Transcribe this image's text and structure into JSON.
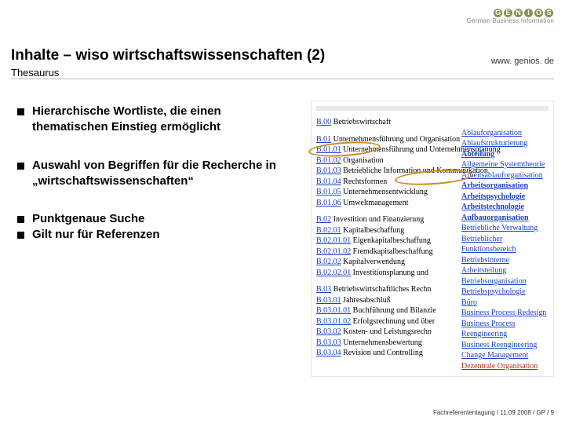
{
  "logo": {
    "letters": [
      "G",
      "E",
      "N",
      "I",
      "O",
      "S"
    ],
    "sub": "German Business Information"
  },
  "header": {
    "title": "Inhalte – wiso wirtschaftswissenschaften (2)",
    "subtitle": "Thesaurus",
    "url": "www. genios. de"
  },
  "bullets": {
    "g1": "Hierarchische Wortliste, die einen thematischen Einstieg ermöglicht",
    "g2": "Auswahl von Begriffen für die Recherche in „wirtschaftswissenschaften“",
    "g3a": "Punktgenaue Suche",
    "g3b": "Gilt nur für Referenzen"
  },
  "shot": {
    "b00": {
      "code": "B.00",
      "lbl": "Betriebswirtschaft"
    },
    "l": [
      {
        "c": "B.01",
        "t": "Unternehmensführung und Organisation"
      },
      {
        "c": "B.01.01",
        "t": "Unternehmensführung und Unternehmensplanung"
      },
      {
        "c": "B.01.02",
        "t": "Organisation"
      },
      {
        "c": "B.01.03",
        "t": "Betriebliche Information und Kommunikation"
      },
      {
        "c": "B.01.04",
        "t": "Rechtsformen"
      },
      {
        "c": "B.01.05",
        "t": "Unternehmensentwicklung"
      },
      {
        "c": "B.01.06",
        "t": "Umweltmanagement"
      }
    ],
    "l2": [
      {
        "c": "B.02",
        "t": "Investition und Finanzierung"
      },
      {
        "c": "B.02.01",
        "t": "Kapitalbeschaffung"
      },
      {
        "c": "B.02.01.01",
        "t": "Eigenkapitalbeschaffung"
      },
      {
        "c": "B.02.01.02",
        "t": "Fremdkapitalbeschaffung"
      },
      {
        "c": "B.02.02",
        "t": "Kapitalverwendung"
      },
      {
        "c": "B.02.02.01",
        "t": "Investitionsplanung und"
      }
    ],
    "l3": [
      {
        "c": "B.03",
        "t": "Betriebswirtschaftliches Rechn"
      },
      {
        "c": "B.03.01",
        "t": "Jahresabschluß"
      },
      {
        "c": "B.03.01.01",
        "t": "Buchführung und Bilanzie"
      },
      {
        "c": "B.03.01.02",
        "t": "Erfolgsrechnung und über"
      },
      {
        "c": "B.03.02",
        "t": "Kosten- und Leistungsrechn"
      },
      {
        "c": "B.03.03",
        "t": "Unternehmensbewertung"
      },
      {
        "c": "B.03.04",
        "t": "Revision und Controlling"
      }
    ],
    "r": [
      "Ablauforganisation",
      "Ablaufstrukturierung",
      "Abteilung",
      "Allgemeine Systemtheorie",
      "Arbeitsablauforganisation",
      "Arbeitsorganisation",
      "Arbeitspsychologie",
      "Arbeitstechnologie",
      "Aufbauorganisation",
      "Betriebliche Verwaltung",
      "Betrieblicher Funktionsbereich",
      "Betriebsinterne Arbeitsteilung",
      "Betriebsorganisation",
      "Betriebspsychologie",
      "Büro",
      "Business Process Redesign",
      "Business Process Reengineering",
      "Business Reengineering",
      "Change Management",
      "Dezentrale Organisation"
    ],
    "bold": [
      2,
      5,
      6,
      7,
      8
    ],
    "hot": [
      19
    ]
  },
  "footer": "Fachreferententagung / 11.09.2008 / GP / 9"
}
